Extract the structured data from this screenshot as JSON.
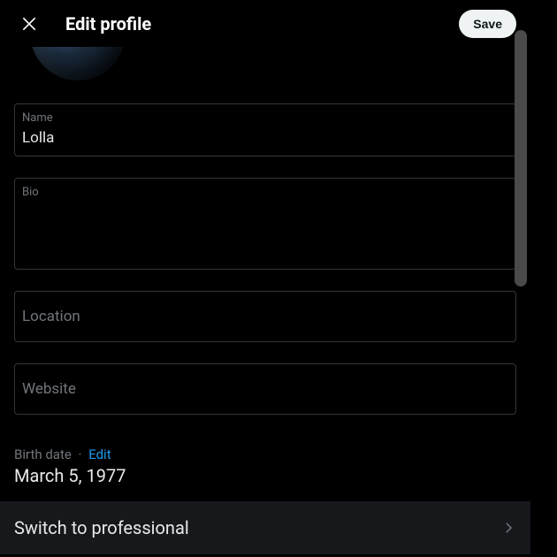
{
  "header": {
    "title": "Edit profile",
    "save_label": "Save"
  },
  "fields": {
    "name": {
      "label": "Name",
      "value": "Lolla"
    },
    "bio": {
      "label": "Bio",
      "value": ""
    },
    "location": {
      "label": "Location",
      "value": ""
    },
    "website": {
      "label": "Website",
      "value": ""
    }
  },
  "birth": {
    "label": "Birth date",
    "separator": "·",
    "edit_label": "Edit",
    "value": "March 5, 1977"
  },
  "switch": {
    "label": "Switch to professional"
  }
}
